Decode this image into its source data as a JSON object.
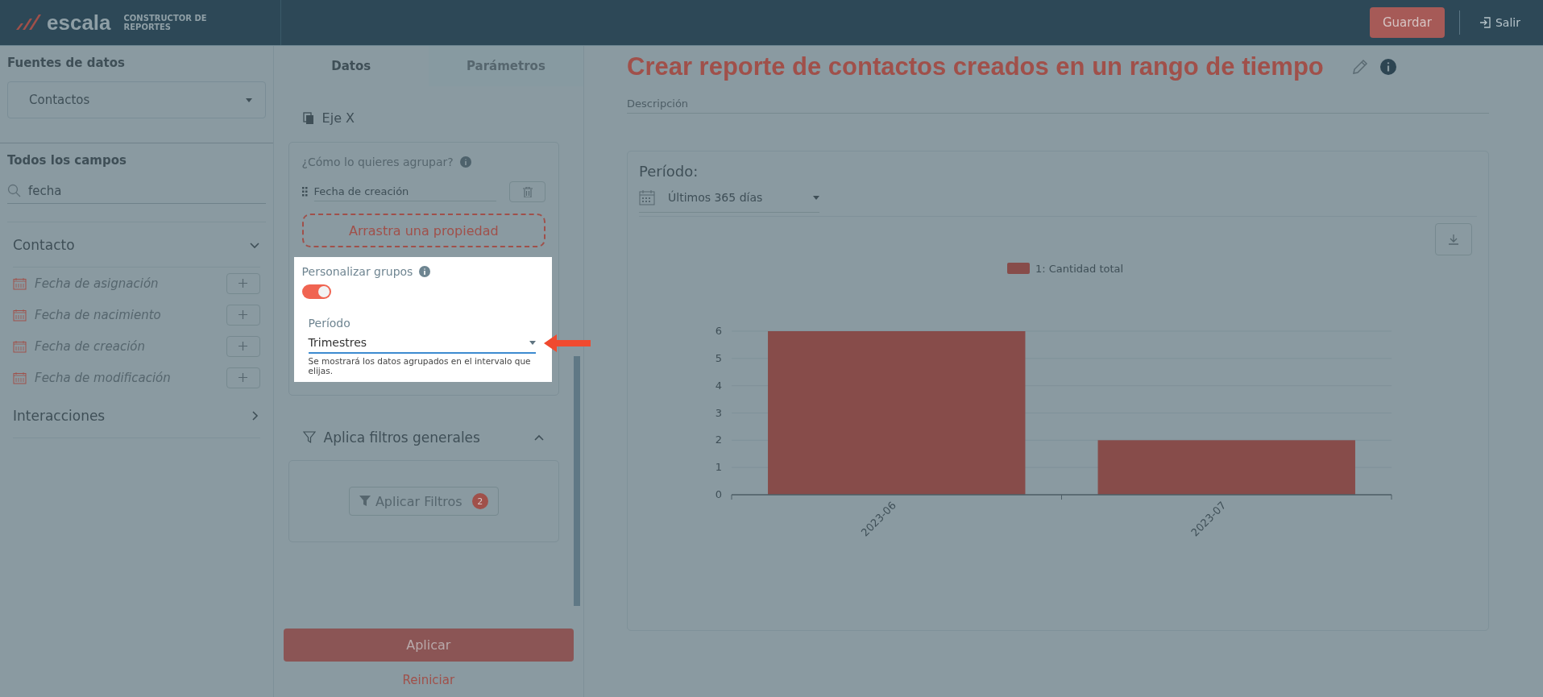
{
  "header": {
    "logo_text": "escala",
    "logo_subtitle": "CONSTRUCTOR DE REPORTES",
    "save_button": "Guardar",
    "exit_button": "Salir"
  },
  "sidebar": {
    "data_sources_label": "Fuentes de datos",
    "data_source": "Contactos",
    "fields_label": "Todos los campos",
    "search_value": "fecha",
    "groups": [
      {
        "title": "Contacto",
        "expanded": true,
        "fields": [
          "Fecha de asignación",
          "Fecha de nacimiento",
          "Fecha de creación",
          "Fecha de modificación"
        ]
      },
      {
        "title": "Interacciones",
        "expanded": false
      }
    ]
  },
  "config_panel": {
    "tabs": [
      {
        "label": "Datos",
        "selected": true
      },
      {
        "label": "Parámetros",
        "selected": false
      }
    ],
    "x_axis_title": "Eje X",
    "group_question": "¿Cómo lo quieres agrupar?",
    "group_field": "Fecha de creación",
    "drop_zone": "Arrastra una propiedad",
    "customize_label": "Personalizar grupos",
    "customize_on": true,
    "period_label": "Período",
    "period_value": "Trimestres",
    "period_hint": "Se mostrará los datos agrupados en el intervalo que elijas.",
    "filters_title": "Aplica filtros generales",
    "filters_expanded": true,
    "apply_filters_button": "Aplicar Filtros",
    "filter_count": "2",
    "apply_button": "Aplicar",
    "reset_button": "Reiniciar"
  },
  "report": {
    "title": "Crear reporte de contactos creados en un rango de tiempo",
    "description_placeholder": "Descripción",
    "period_label": "Período:",
    "period_value": "Últimos 365 días",
    "chart_data": {
      "type": "bar",
      "categories": [
        "2023-06",
        "2023-07"
      ],
      "series": [
        {
          "name": "1: Cantidad total",
          "color": "#874c4a",
          "values": [
            6,
            2
          ]
        }
      ],
      "grid": true,
      "ylim": [
        0,
        6
      ],
      "yticks": [
        0,
        1,
        2,
        3,
        4,
        5,
        6
      ]
    }
  }
}
